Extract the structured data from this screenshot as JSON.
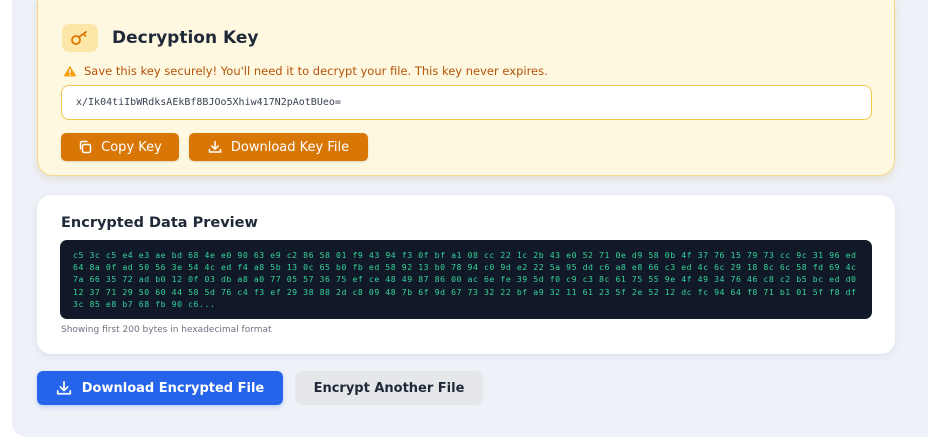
{
  "key_section": {
    "title": "Decryption Key",
    "warning": "Save this key securely! You'll need it to decrypt your file. This key never expires.",
    "key_value": "x/Ik04tiIbWRdksAEkBf8BJOo5Xhiw417N2pAotBUeo=",
    "copy_label": "Copy Key",
    "download_label": "Download Key File"
  },
  "preview_section": {
    "title": "Encrypted Data Preview",
    "hex": "c5 3c c5 e4 e3 ae bd 68 4e e0 90 63 e9 c2 86 58 01 f9 43 94 f3 0f bf a1 08 cc 22 1c 2b 43 e0 52 71 0e d9 58 0b 4f 37 76 15 79 73 cc 9c 31 96 ed 64 8a 0f ad 50 56 3e 54 4c ed f4 a8 5b 13 0c 65 b0 fb ed 58 92 13 b0 78 94 c0 9d e2 22 5a 95 dd c6 a8 e8 66 c3 ed 4c 6c 29 18 8c 6c 58 fd 69 4c 7a 66 35 72 ad b0 12 0f 03 db a8 a0 77 05 57 36 75 ef ce 48 49 87 86 00 ac 6e fe 39 5d f0 c9 c3 8c 61 75 55 9e 4f 49 34 76 46 c8 c2 b5 bc ed d0 12 37 71 29 50 60 44 58 5d 76 c4 f3 ef 29 38 88 2d c8 09 48 7b 6f 9d 67 73 32 22 bf a9 32 11 61 23 5f 2e 52 12 dc fc 94 64 f8 71 b1 01 5f f8 df 3c 85 e8 b7 68 fb 90 c6...",
    "note": "Showing first 200 bytes in hexadecimal format"
  },
  "actions": {
    "download_encrypted_label": "Download Encrypted File",
    "encrypt_another_label": "Encrypt Another File"
  },
  "icons": {
    "key": "key-icon",
    "warning": "warning-icon",
    "copy": "copy-icon",
    "download": "download-icon"
  },
  "colors": {
    "accent_orange": "#d97706",
    "key_card_bg": "#fff8e1",
    "primary_blue": "#2563eb",
    "hex_text": "#34d399",
    "hex_bg": "#111827"
  }
}
